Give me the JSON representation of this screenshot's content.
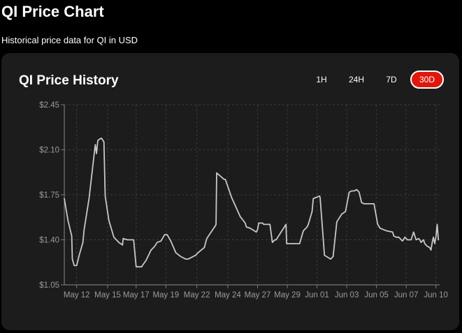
{
  "header": {
    "title": "QI Price Chart",
    "subtitle": "Historical price data for QI in USD"
  },
  "card": {
    "title": "QI Price History"
  },
  "ranges": [
    {
      "label": "1H",
      "active": false
    },
    {
      "label": "24H",
      "active": false
    },
    {
      "label": "7D",
      "active": false
    },
    {
      "label": "30D",
      "active": true
    }
  ],
  "colors": {
    "accent": "#e0180c",
    "line": "#c8c8c8",
    "grid": "#3a3a3a",
    "card_bg": "#1c1c1c"
  },
  "chart_data": {
    "type": "line",
    "title": "",
    "xlabel": "",
    "ylabel": "",
    "ylim": [
      1.05,
      2.45
    ],
    "xlim": [
      0,
      30.3
    ],
    "grid": true,
    "y_ticks": [
      {
        "v": 1.05,
        "label": "$1.05"
      },
      {
        "v": 1.4,
        "label": "$1.40"
      },
      {
        "v": 1.75,
        "label": "$1.75"
      },
      {
        "v": 2.1,
        "label": "$2.10"
      },
      {
        "v": 2.45,
        "label": "$2.45"
      }
    ],
    "x_ticks": [
      {
        "v": 1.0,
        "label": "May 12"
      },
      {
        "v": 3.5,
        "label": "May 15"
      },
      {
        "v": 5.8,
        "label": "May 17"
      },
      {
        "v": 8.2,
        "label": "May 19"
      },
      {
        "v": 10.7,
        "label": "May 22"
      },
      {
        "v": 13.2,
        "label": "May 24"
      },
      {
        "v": 15.6,
        "label": "May 27"
      },
      {
        "v": 18.0,
        "label": "May 29"
      },
      {
        "v": 20.4,
        "label": "Jun 01"
      },
      {
        "v": 22.8,
        "label": "Jun 03"
      },
      {
        "v": 25.2,
        "label": "Jun 05"
      },
      {
        "v": 27.6,
        "label": "Jun 07"
      },
      {
        "v": 30.0,
        "label": "Jun 10"
      }
    ],
    "series": [
      {
        "x": [
          0.0,
          0.3,
          0.6,
          0.65,
          0.8,
          1.0,
          1.2,
          1.5,
          1.6,
          2.0,
          2.5,
          2.6,
          2.7,
          2.8,
          3.0,
          3.2,
          3.3,
          3.6,
          4.0,
          4.4,
          4.7,
          4.75,
          5.1,
          5.4,
          5.45,
          5.6,
          5.8,
          6.1,
          6.25,
          6.3,
          6.6,
          7.0,
          7.3,
          7.5,
          7.8,
          8.1,
          8.3,
          8.6,
          9.0,
          9.4,
          9.8,
          10.0,
          10.2,
          10.6,
          10.8,
          11.3,
          11.5,
          12.2,
          12.25,
          12.3,
          12.9,
          13.0,
          13.5,
          14.2,
          14.6,
          14.7,
          15.0,
          15.5,
          15.6,
          15.7,
          16.0,
          16.1,
          16.5,
          16.6,
          16.8,
          17.0,
          17.1,
          17.9,
          17.95,
          18.0,
          18.3,
          19.0,
          19.3,
          19.6,
          19.7,
          20.0,
          20.1,
          20.6,
          20.65,
          21.0,
          21.5,
          21.7,
          22.0,
          22.2,
          22.4,
          22.7,
          23.0,
          23.2,
          23.4,
          23.6,
          23.8,
          24.0,
          24.2,
          24.5,
          25.0,
          25.3,
          25.5,
          26.0,
          26.5,
          26.6,
          26.8,
          27.0,
          27.3,
          27.5,
          27.7,
          28.0,
          28.2,
          28.4,
          28.6,
          28.7,
          28.8,
          29.0,
          29.1,
          29.3,
          29.5,
          29.6,
          29.7,
          29.8,
          29.9,
          30.0,
          30.1,
          30.2
        ],
        "y": [
          1.72,
          1.55,
          1.43,
          1.25,
          1.2,
          1.2,
          1.28,
          1.38,
          1.48,
          1.72,
          2.14,
          2.07,
          2.17,
          2.18,
          2.19,
          2.16,
          1.74,
          1.55,
          1.42,
          1.38,
          1.36,
          1.41,
          1.4,
          1.4,
          1.4,
          1.4,
          1.19,
          1.19,
          1.19,
          1.2,
          1.24,
          1.32,
          1.35,
          1.38,
          1.39,
          1.44,
          1.44,
          1.39,
          1.3,
          1.27,
          1.25,
          1.25,
          1.26,
          1.28,
          1.3,
          1.34,
          1.41,
          1.51,
          1.52,
          1.92,
          1.87,
          1.87,
          1.73,
          1.58,
          1.53,
          1.5,
          1.49,
          1.46,
          1.48,
          1.53,
          1.53,
          1.52,
          1.52,
          1.52,
          1.38,
          1.4,
          1.4,
          1.52,
          1.37,
          1.37,
          1.37,
          1.37,
          1.47,
          1.5,
          1.52,
          1.62,
          1.72,
          1.74,
          1.73,
          1.28,
          1.25,
          1.27,
          1.54,
          1.57,
          1.6,
          1.62,
          1.77,
          1.78,
          1.78,
          1.79,
          1.77,
          1.69,
          1.68,
          1.68,
          1.68,
          1.52,
          1.49,
          1.47,
          1.46,
          1.43,
          1.42,
          1.42,
          1.39,
          1.42,
          1.4,
          1.4,
          1.46,
          1.4,
          1.41,
          1.4,
          1.38,
          1.4,
          1.37,
          1.35,
          1.34,
          1.32,
          1.38,
          1.42,
          1.37,
          1.42,
          1.52,
          1.4
        ]
      }
    ]
  }
}
